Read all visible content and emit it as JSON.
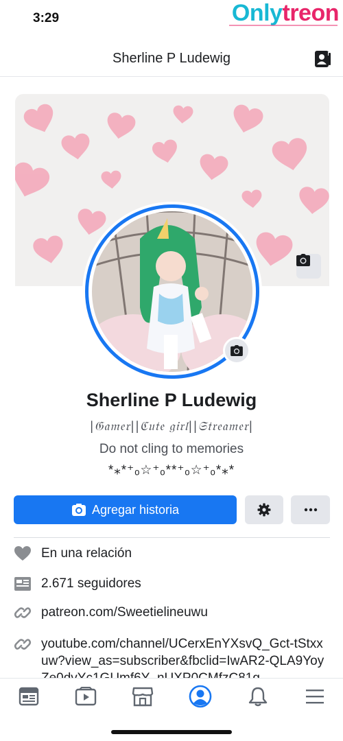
{
  "status_bar": {
    "time": "3:29"
  },
  "watermark": {
    "part_a": "Only",
    "part_b": "treon"
  },
  "header": {
    "title": "Sherline P Ludewig"
  },
  "profile": {
    "name": "Sherline P Ludewig",
    "bio_line_1": "|𝔊𝔞𝔪𝔢𝔯||ℭ𝔲𝔱𝔢 𝔤𝔦𝔯𝔩||𝔖𝔱𝔯𝔢𝔞𝔪𝔢𝔯|",
    "bio_line_2": "Do not cling to memories",
    "bio_line_3": "*⁎*⁺ₒ☆⁺ₒ**⁺ₒ☆⁺ₒ*⁎*"
  },
  "actions": {
    "add_story_label": "Agregar historia"
  },
  "info": {
    "relationship": "En una relación",
    "followers": "2.671 seguidores",
    "patreon_link": "patreon.com/Sweetielineuwu",
    "youtube_link": "youtube.com/channel/UCerxEnYXsvQ_Gct-tStxxuw?view_as=subscriber&fbclid=IwAR2-QLA9YoyZe0dvYc1GUmf6Y_nUXP0CMfzC81g"
  },
  "tabs": [
    "news-feed",
    "watch",
    "marketplace",
    "profile",
    "notifications",
    "menu"
  ],
  "colors": {
    "accent": "#1877f2",
    "button_gray": "#e4e6eb",
    "heart_pink": "#f4a6b8"
  }
}
